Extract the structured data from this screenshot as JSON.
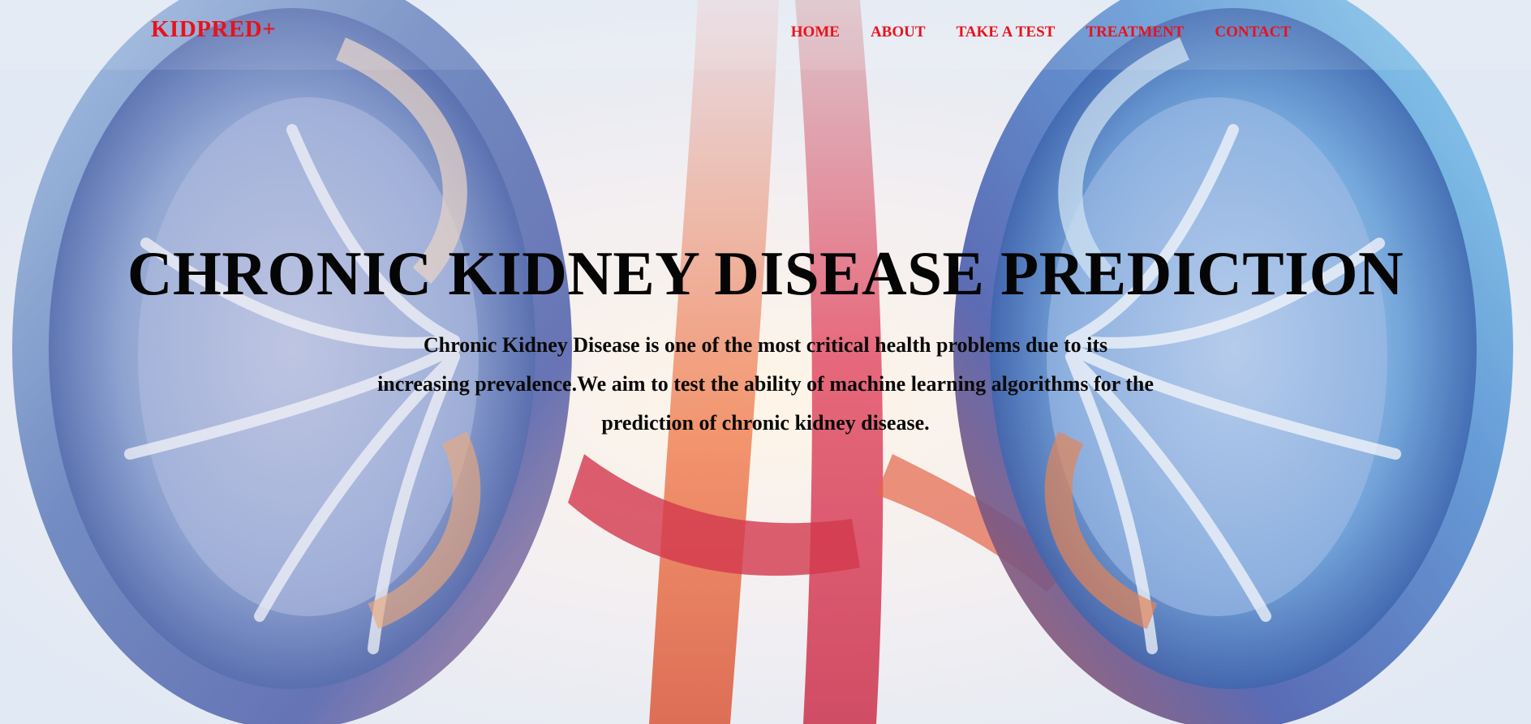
{
  "theme": {
    "brand_color": "#e8121c",
    "nav_color": "#e8121c"
  },
  "navbar": {
    "brand": "KIDPRED+",
    "links": [
      {
        "label": "HOME"
      },
      {
        "label": "ABOUT"
      },
      {
        "label": "TAKE A TEST"
      },
      {
        "label": "TREATMENT"
      },
      {
        "label": "CONTACT"
      }
    ]
  },
  "hero": {
    "title": "CHRONIC KIDNEY DISEASE PREDICTION",
    "description": "Chronic Kidney Disease is one of the most critical health problems due to its increasing prevalence.We aim to test the ability of machine learning algorithms for the prediction of chronic kidney disease.",
    "background_image": "kidney-illustration"
  }
}
